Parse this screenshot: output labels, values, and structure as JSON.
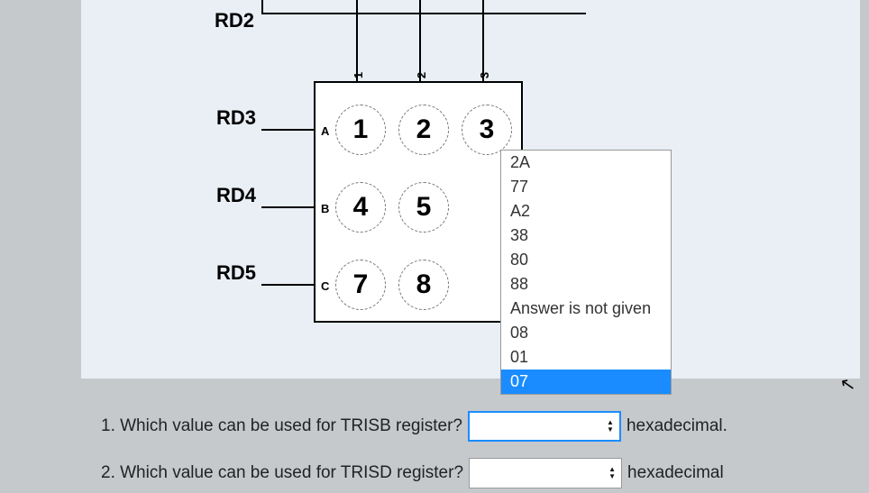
{
  "pins": {
    "rd2": "RD2",
    "rd3": "RD3",
    "rd4": "RD4",
    "rd5": "RD5"
  },
  "keypad": {
    "cols": [
      "1",
      "2",
      "3"
    ],
    "rows": [
      "A",
      "B",
      "C"
    ],
    "keys": {
      "a1": "1",
      "a2": "2",
      "a3": "3",
      "b1": "4",
      "b2": "5",
      "c1": "7",
      "c2": "8"
    }
  },
  "dropdown": {
    "options": [
      "2A",
      "77",
      "A2",
      "38",
      "80",
      "88",
      "Answer is not given",
      "08",
      "01",
      "07"
    ],
    "highlighted": "07"
  },
  "questions": {
    "q1": {
      "text": "1. Which value can be used for TRISB register?",
      "unit": "hexadecimal."
    },
    "q2": {
      "text": "2. Which value can be used for TRISD register?",
      "unit": "hexadecimal"
    }
  }
}
